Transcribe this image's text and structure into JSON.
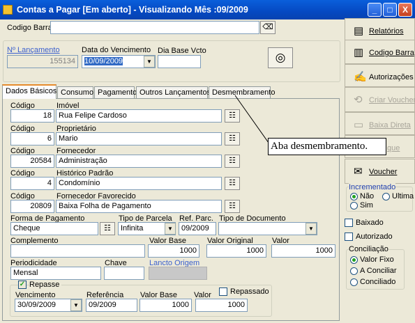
{
  "window": {
    "title": "Contas a Pagar [Em aberto] - Visualizando Mês :09/2009",
    "minimize": "_",
    "maximize": "□",
    "close": "X"
  },
  "header": {
    "codigo_barra_label": "Codigo Barra",
    "codigo_barra_value": "",
    "lancamento_label": "Nº Lançamento",
    "lancamento_value": "155134",
    "vencimento_label": "Data do Vencimento",
    "vencimento_value": "10/09/2009",
    "dia_base_label": "Dia Base Vcto",
    "dia_base_value": ""
  },
  "tabs": [
    "Dados Básicos",
    "Consumo",
    "Pagamento",
    "Outros Lançamentos",
    "Desmembramento"
  ],
  "callout": "Aba desmembramento.",
  "fields": {
    "codigo_label": "Código",
    "imovel_label": "Imóvel",
    "imovel_code": "18",
    "imovel_value": "Rua Felipe Cardoso",
    "proprietario_label": "Proprietário",
    "proprietario_code": "6",
    "proprietario_value": "Mario",
    "fornecedor_label": "Fornecedor",
    "fornecedor_code": "20584",
    "fornecedor_value": "Administração",
    "historico_label": "Histórico Padrão",
    "historico_code": "4",
    "historico_value": "Condomínio",
    "favorecido_label": "Fornecedor Favorecido",
    "favorecido_code": "20809",
    "favorecido_value": "Baixa Folha de Pagamento",
    "forma_pagamento_label": "Forma de Pagamento",
    "forma_pagamento_value": "Cheque",
    "tipo_parcela_label": "Tipo de Parcela",
    "tipo_parcela_value": "Infinita",
    "ref_parc_label": "Ref. Parc.",
    "ref_parc_value": "09/2009",
    "tipo_documento_label": "Tipo de Documento",
    "tipo_documento_value": "",
    "complemento_label": "Complemento",
    "complemento_value": "",
    "valor_base_label": "Valor Base",
    "valor_base_value": "1000",
    "valor_original_label": "Valor Original",
    "valor_original_value": "1000",
    "valor_label": "Valor",
    "valor_value": "1000",
    "periodicidade_label": "Periodicidade",
    "periodicidade_value": "Mensal",
    "chave_label": "Chave",
    "chave_value": "",
    "lancto_origem_label": "Lancto Origem",
    "lancto_origem_value": ""
  },
  "repasse": {
    "label": "Repasse",
    "checked": true,
    "vencimento_label": "Vencimento",
    "vencimento_value": "30/09/2009",
    "referencia_label": "Referência",
    "referencia_value": "09/2009",
    "valor_base_label": "Valor Base",
    "valor_base_value": "1000",
    "valor_label": "Valor",
    "valor_value": "1000",
    "repassado_label": "Repassado",
    "repassado_checked": false
  },
  "right_buttons": [
    {
      "label": "Relatórios",
      "icon": "report-icon",
      "enabled": true
    },
    {
      "label": "Codigo Barra",
      "icon": "barcode-icon",
      "enabled": true
    },
    {
      "label": "Autorizações",
      "icon": "authorization-icon",
      "enabled": true
    },
    {
      "label": "Criar Voucher",
      "icon": "create-voucher-icon",
      "enabled": false
    },
    {
      "label": "Baixa Direta",
      "icon": "direct-payment-icon",
      "enabled": false
    },
    {
      "label": "que",
      "icon": "check-icon",
      "enabled": false
    },
    {
      "label": "Voucher",
      "icon": "voucher-icon",
      "enabled": true
    }
  ],
  "incrementado": {
    "label": "Incrementado",
    "options": [
      "Não",
      "Ultima",
      "Sim"
    ],
    "selected": "Não"
  },
  "baixado_label": "Baixado",
  "autorizado_label": "Autorizado",
  "conciliacao": {
    "label": "Conciliação",
    "options": [
      "Valor Fixo",
      "A Conciliar",
      "Conciliado"
    ],
    "selected": "Valor Fixo"
  },
  "colors": {
    "titlebar": "#0549C2",
    "active_tab_accent": "#E68B2C",
    "field_border": "#7F9DB9",
    "link_label": "#3A5FCD",
    "group_label": "#1F3FAF"
  }
}
